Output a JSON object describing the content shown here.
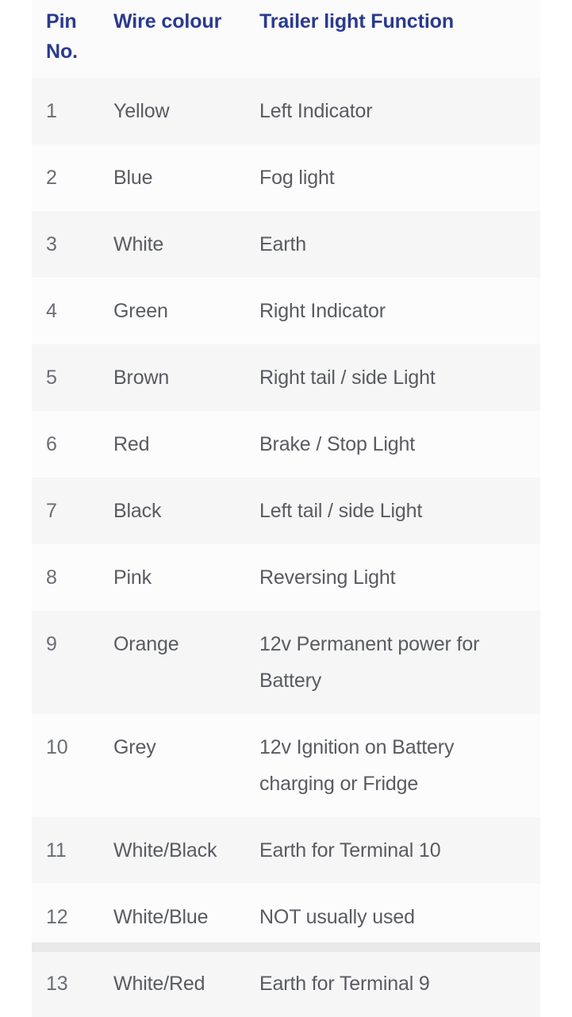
{
  "table": {
    "name": "trailer-13-pin-wiring-table",
    "columns": [
      {
        "key": "pin",
        "label": "Pin No."
      },
      {
        "key": "colour",
        "label": "Wire colour"
      },
      {
        "key": "function",
        "label": "Trailer light Function"
      }
    ],
    "rows": [
      {
        "pin": "1",
        "colour": "Yellow",
        "function": "Left Indicator"
      },
      {
        "pin": "2",
        "colour": "Blue",
        "function": "Fog light"
      },
      {
        "pin": "3",
        "colour": "White",
        "function": "Earth"
      },
      {
        "pin": "4",
        "colour": "Green",
        "function": "Right Indicator"
      },
      {
        "pin": "5",
        "colour": "Brown",
        "function": "Right tail / side Light"
      },
      {
        "pin": "6",
        "colour": "Red",
        "function": "Brake / Stop Light"
      },
      {
        "pin": "7",
        "colour": "Black",
        "function": "Left tail / side Light"
      },
      {
        "pin": "8",
        "colour": "Pink",
        "function": "Reversing Light"
      },
      {
        "pin": "9",
        "colour": "Orange",
        "function": "12v Permanent power for Battery"
      },
      {
        "pin": "10",
        "colour": "Grey",
        "function": "12v Ignition on Battery charging or Fridge"
      },
      {
        "pin": "11",
        "colour": "White/Black",
        "function": "Earth for Terminal 10"
      },
      {
        "pin": "12",
        "colour": "White/Blue",
        "function": "NOT usually used"
      },
      {
        "pin": "13",
        "colour": "White/Red",
        "function": "Earth for Terminal 9"
      }
    ]
  },
  "colors": {
    "header_text": "#2a3a8e",
    "body_text": "#595b60",
    "pin_text": "#6b6d72",
    "row_odd_bg": "#f6f6f7",
    "row_even_bg": "#fcfcfd",
    "header_bg": "#fbfbfc",
    "page_bg": "#ffffff",
    "next_section_bg": "#e9e9ea"
  }
}
